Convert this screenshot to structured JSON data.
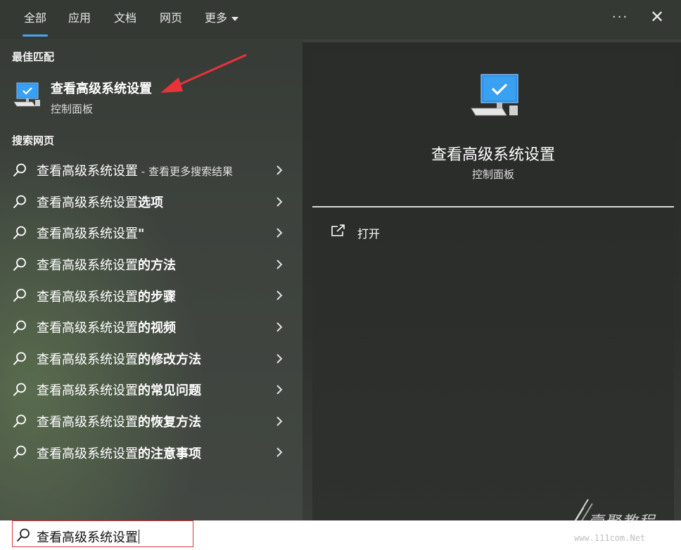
{
  "tabs": [
    {
      "label": "全部",
      "active": true
    },
    {
      "label": "应用"
    },
    {
      "label": "文档"
    },
    {
      "label": "网页"
    },
    {
      "label": "更多"
    }
  ],
  "sections": {
    "best_match": "最佳匹配",
    "search_web": "搜索网页"
  },
  "best_match": {
    "title": "查看高级系统设置",
    "subtitle": "控制面板",
    "icon": "computer-settings-icon"
  },
  "results": [
    {
      "base": "查看高级系统设置",
      "bold": "",
      "suffix": " - 查看更多搜索结果"
    },
    {
      "base": "查看高级系统设置",
      "bold": "选项",
      "suffix": ""
    },
    {
      "base": "查看高级系统设置",
      "bold": "\"",
      "suffix": ""
    },
    {
      "base": "查看高级系统设置",
      "bold": "的方法",
      "suffix": ""
    },
    {
      "base": "查看高级系统设置",
      "bold": "的步骤",
      "suffix": ""
    },
    {
      "base": "查看高级系统设置",
      "bold": "的视频",
      "suffix": ""
    },
    {
      "base": "查看高级系统设置",
      "bold": "的修改方法",
      "suffix": ""
    },
    {
      "base": "查看高级系统设置",
      "bold": "的常见问题",
      "suffix": ""
    },
    {
      "base": "查看高级系统设置",
      "bold": "的恢复方法",
      "suffix": ""
    },
    {
      "base": "查看高级系统设置",
      "bold": "的注意事项",
      "suffix": ""
    }
  ],
  "detail": {
    "title": "查看高级系统设置",
    "subtitle": "控制面板",
    "open_label": "打开"
  },
  "search": {
    "value": "查看高级系统设置"
  },
  "watermark": {
    "text": "壹聚教程",
    "url": "www.111com.Net"
  },
  "colors": {
    "accent": "#4aa3f0",
    "highlight_border": "#d9363e",
    "arrow": "#e8333a"
  }
}
